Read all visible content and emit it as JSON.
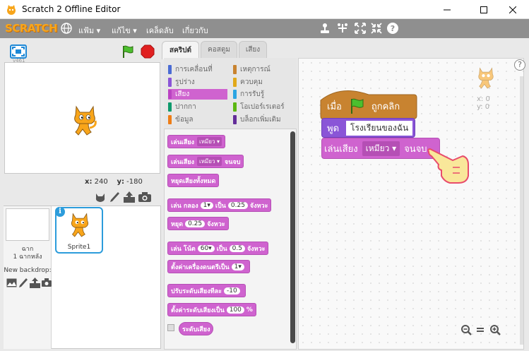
{
  "window": {
    "title": "Scratch 2 Offline Editor",
    "minimize": "—",
    "maximize": "☐",
    "close": "✕"
  },
  "menubar": {
    "logo": "SCRATCH",
    "file": "แฟ้ม ▾",
    "edit": "แก้ไข ▾",
    "tips": "เคล็ดลับ",
    "about": "เกี่ยวกับ"
  },
  "stage": {
    "version": "v461",
    "x_label": "x:",
    "x_value": "240",
    "y_label": "y:",
    "y_value": "-180"
  },
  "sprites": {
    "stage_label": "ฉาก",
    "stage_count": "1 ฉากหลัง",
    "new_backdrop": "New backdrop:",
    "sprite1": "Sprite1"
  },
  "tabs": {
    "scripts": "สคริปต์",
    "costumes": "คอสตูม",
    "sounds": "เสียง"
  },
  "categories": [
    {
      "label": "การเคลื่อนที่",
      "color": "#4a6cd4"
    },
    {
      "label": "รูปร่าง",
      "color": "#8a55d7"
    },
    {
      "label": "เสียง",
      "color": "#bb42c3"
    },
    {
      "label": "ปากกา",
      "color": "#0e9a6c"
    },
    {
      "label": "ข้อมูล",
      "color": "#ee7d16"
    },
    {
      "label": "เหตุการณ์",
      "color": "#c88330"
    },
    {
      "label": "ควบคุม",
      "color": "#e1a91a"
    },
    {
      "label": "การรับรู้",
      "color": "#2ca5e2"
    },
    {
      "label": "โอเปอร์เรเตอร์",
      "color": "#5cb712"
    },
    {
      "label": "บล็อกเพิ่มเติม",
      "color": "#632d99"
    }
  ],
  "palette": {
    "play_sound": "เล่นเสียง",
    "meow": "เหมียว",
    "play_sound_until": "จนจบ",
    "stop_all": "หยุดเสียงทั้งหมด",
    "play_drum": "เล่น กลอง",
    "drum_val": "1",
    "for": "เป็น",
    "beats_val": "0.25",
    "beats": "จังหวะ",
    "rest": "หยุด",
    "rest_val": "0.25",
    "rest_beats": "จังหวะ",
    "play_note": "เล่น โน้ต",
    "note_val": "60",
    "note_for": "เป็น",
    "note_beats_val": "0.5",
    "note_beats": "จังหวะ",
    "set_instrument": "ตั้งค่าเครื่องดนตรีเป็น",
    "instr_val": "1",
    "change_volume": "ปรับระดับเสียงทีละ",
    "change_val": "-10",
    "set_volume": "ตั้งค่าระดับเสียงเป็น",
    "set_vol_val": "100",
    "percent": "%",
    "volume": "ระดับเสียง"
  },
  "scripts": {
    "when": "เมื่อ",
    "clicked": "ถูกคลิก",
    "say": "พูด",
    "say_text": "โรงเรียนของฉัน",
    "play_sound": "เล่นเสียง",
    "meow": "เหมียว",
    "until_done": "จนจบ",
    "sprite_x": "x: 0",
    "sprite_y": "y: 0",
    "zoom_out": "−",
    "zoom_reset": "=",
    "zoom_in": "+",
    "help": "?"
  }
}
